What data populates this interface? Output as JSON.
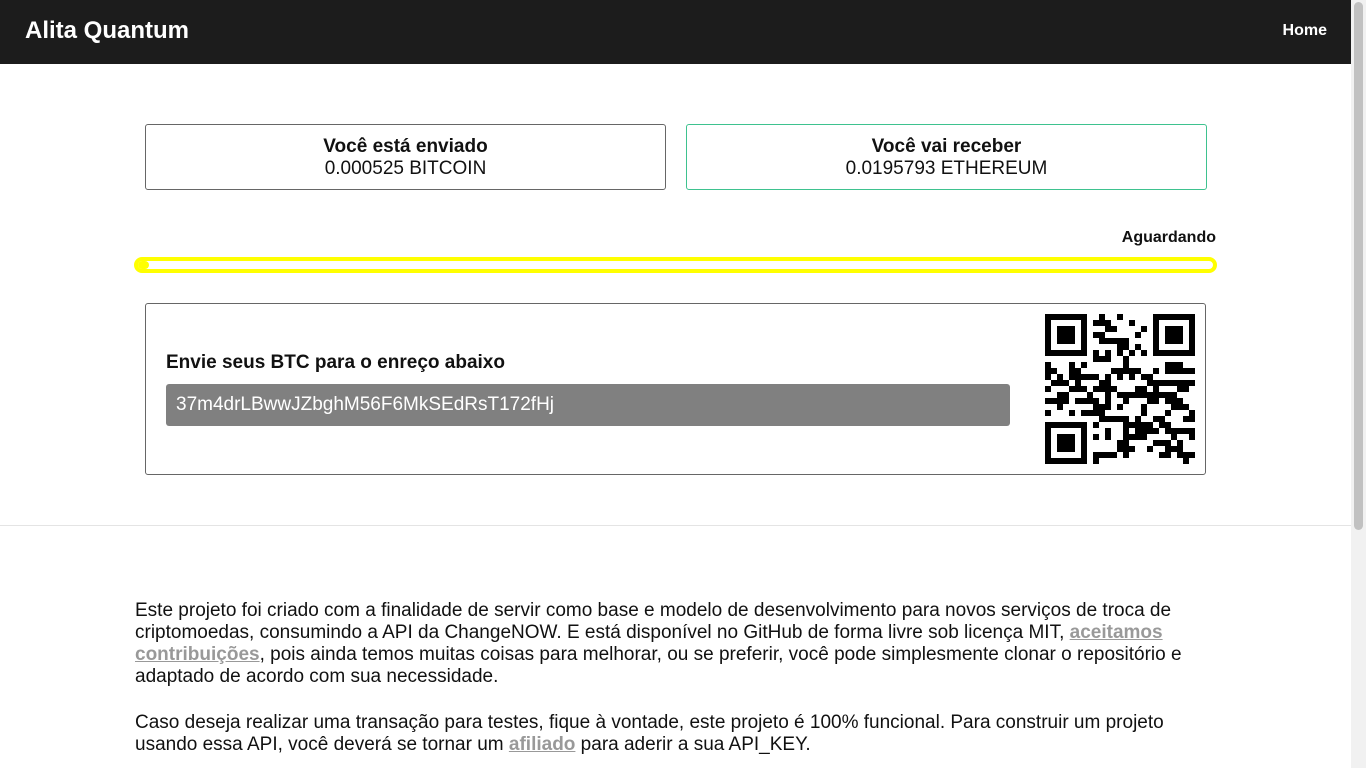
{
  "navbar": {
    "brand": "Alita Quantum",
    "home_label": "Home"
  },
  "exchange": {
    "send": {
      "title": "Você está enviado",
      "amount": "0.000525 BITCOIN"
    },
    "receive": {
      "title": "Você vai receber",
      "amount": "0.0195793 ETHEREUM"
    }
  },
  "status": {
    "label": "Aguardando",
    "progress_fraction": 0.01,
    "color": "#ffff00"
  },
  "deposit": {
    "title": "Envie seus BTC para o enreço abaixo",
    "address": "37m4drLBwwJZbghM56F6MkSEdRsT172fHj"
  },
  "about": {
    "p1_start": "Este projeto foi criado com a finalidade de servir como base e modelo de desenvolvimento para novos serviços de troca de criptomoedas, consumindo a API da ChangeNOW. E está disponível no GitHub de forma livre sob licença MIT, ",
    "p1_link": "aceitamos contribuições",
    "p1_end": ", pois ainda temos muitas coisas para melhorar, ou se preferir, você pode simplesmente clonar o repositório e adaptado de acordo com sua necessidade.",
    "p2_start": "Caso deseja realizar uma transação para testes, fique à vontade, este projeto é 100% funcional. Para construir um projeto usando essa API, você deverá se tornar um ",
    "p2_link": "afiliado",
    "p2_end": " para aderir a sua API_KEY."
  },
  "colors": {
    "navbar_bg": "#1c1c1c",
    "receive_border": "#3ec28f",
    "address_bg": "#808080"
  },
  "icons": {
    "qr": "qr-code-icon"
  }
}
